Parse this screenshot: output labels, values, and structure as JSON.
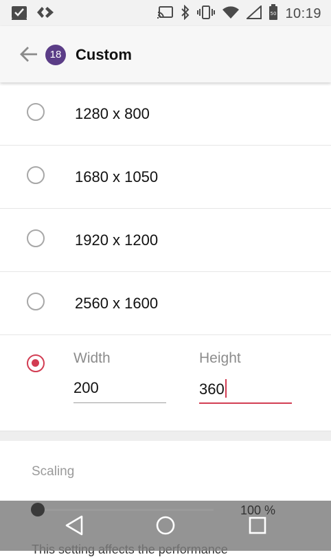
{
  "status_bar": {
    "time": "10:19",
    "battery_level": "50",
    "icons_left": [
      "checkbox-notification-icon",
      "code-notification-icon"
    ],
    "icons_right": [
      "cast-icon",
      "bluetooth-icon",
      "vibrate-icon",
      "wifi-icon",
      "signal-icon",
      "battery-icon"
    ]
  },
  "app_bar": {
    "badge": "18",
    "title": "Custom"
  },
  "options": [
    {
      "label": "1280 x 800",
      "selected": false
    },
    {
      "label": "1680 x 1050",
      "selected": false
    },
    {
      "label": "1920 x 1200",
      "selected": false
    },
    {
      "label": "2560 x 1600",
      "selected": false
    }
  ],
  "custom": {
    "selected": true,
    "width_label": "Width",
    "width_value": "200",
    "height_label": "Height",
    "height_value": "360"
  },
  "scaling": {
    "label": "Scaling",
    "value_label": "100 %",
    "description": "This setting affects the performance"
  },
  "colors": {
    "accent": "#d23c52",
    "badge": "#5b3d87"
  }
}
